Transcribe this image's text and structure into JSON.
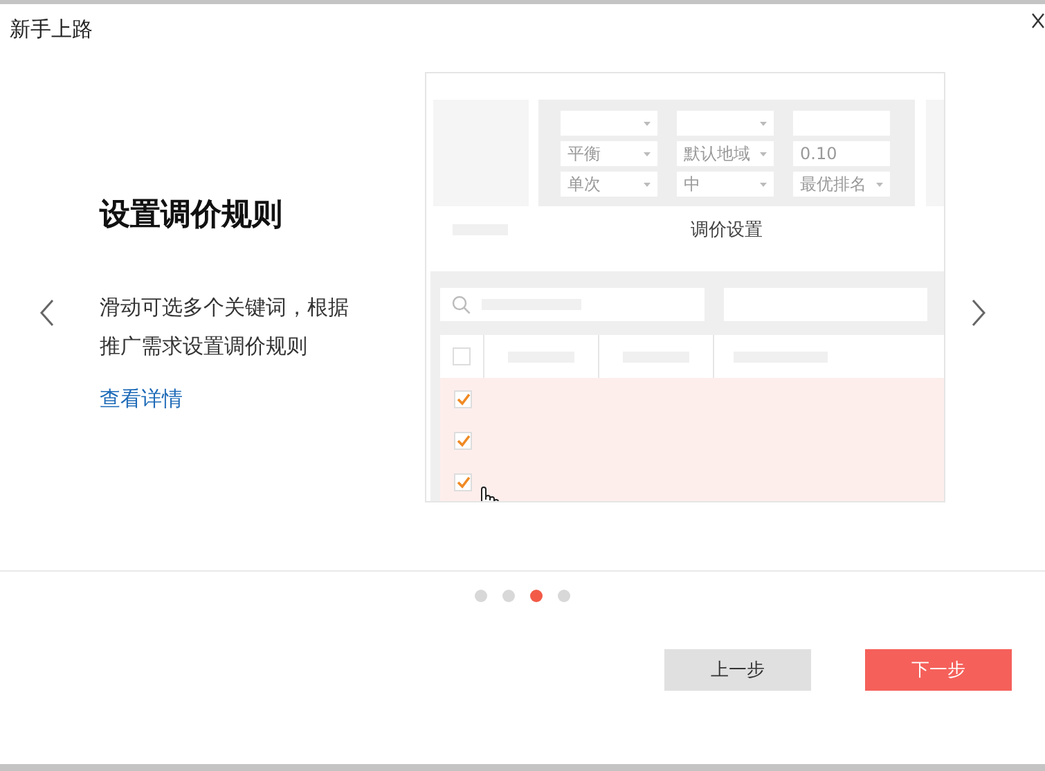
{
  "window": {
    "title": "新手上路"
  },
  "slide": {
    "heading": "设置调价规则",
    "description": "滑动可选多个关键词，根据推广需求设置调价规则",
    "link": "查看详情"
  },
  "illustration": {
    "fields": [
      {
        "kind": "select"
      },
      {
        "kind": "select"
      },
      {
        "kind": "input"
      },
      {
        "kind": "select",
        "value": "平衡"
      },
      {
        "kind": "select",
        "value": "默认地域"
      },
      {
        "kind": "input",
        "value": "0.10"
      },
      {
        "kind": "select",
        "value": "单次"
      },
      {
        "kind": "select",
        "value": "中"
      },
      {
        "kind": "select",
        "value": "最优排名"
      }
    ],
    "caption": "调价设置",
    "header_checked": false,
    "rows": [
      {
        "checked": true
      },
      {
        "checked": true
      },
      {
        "checked": true
      }
    ]
  },
  "pager": [
    {
      "selected": false
    },
    {
      "selected": false
    },
    {
      "selected": true
    },
    {
      "selected": false
    }
  ],
  "buttons": [
    {
      "kind": "secondary",
      "label": "上一步"
    },
    {
      "kind": "primary",
      "label": "下一步"
    }
  ]
}
